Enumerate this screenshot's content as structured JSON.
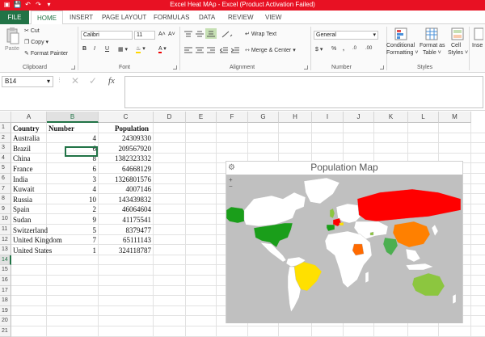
{
  "window": {
    "title": "Excel Heat MAp -  Excel (Product Activation Failed)"
  },
  "ribbon": {
    "tabs": [
      "FILE",
      "HOME",
      "INSERT",
      "PAGE LAYOUT",
      "FORMULAS",
      "DATA",
      "REVIEW",
      "VIEW"
    ],
    "clipboard": {
      "paste": "Paste",
      "cut": "Cut",
      "copy": "Copy",
      "format_painter": "Format Painter",
      "label": "Clipboard"
    },
    "font": {
      "name": "Calibri",
      "size": "11",
      "bold": "B",
      "italic": "I",
      "underline": "U",
      "grow": "A˄",
      "shrink": "A˅",
      "color_a": "A",
      "label": "Font"
    },
    "alignment": {
      "wrap": "Wrap Text",
      "merge": "Merge & Center",
      "label": "Alignment"
    },
    "number": {
      "format": "General",
      "currency": "$",
      "percent": "%",
      "comma": ",",
      "inc": ".0",
      "dec": ".00",
      "label": "Number"
    },
    "styles": {
      "conditional": "Conditional",
      "conditional2": "Formatting ˅",
      "format_as": "Format as",
      "format_as2": "Table ˅",
      "cell": "Cell",
      "cell2": "Styles ˅",
      "label": "Styles"
    },
    "insert": "Inse"
  },
  "formula_bar": {
    "name_box": "B14",
    "fx": "fx",
    "content": ""
  },
  "sheet": {
    "columns": [
      "A",
      "B",
      "C",
      "D",
      "E",
      "F",
      "G",
      "H",
      "I",
      "J",
      "K",
      "L",
      "M"
    ],
    "rows": [
      "1",
      "2",
      "3",
      "4",
      "5",
      "6",
      "7",
      "8",
      "9",
      "10",
      "11",
      "12",
      "13",
      "14",
      "15",
      "16",
      "17",
      "18",
      "19",
      "20",
      "21"
    ],
    "headers": [
      "Country",
      "Number",
      "Population"
    ],
    "data": [
      [
        "Australia",
        "4",
        "24309330"
      ],
      [
        "Brazil",
        "6",
        "209567920"
      ],
      [
        "China",
        "8",
        "1382323332"
      ],
      [
        "France",
        "6",
        "64668129"
      ],
      [
        "India",
        "3",
        "1326801576"
      ],
      [
        "Kuwait",
        "4",
        "4007146"
      ],
      [
        "Russia",
        "10",
        "143439832"
      ],
      [
        "Spain",
        "2",
        "46064604"
      ],
      [
        "Sudan",
        "9",
        "41175541"
      ],
      [
        "Switzerland",
        "5",
        "8379477"
      ],
      [
        "United Kingdom",
        "7",
        "65111143"
      ],
      [
        "United States",
        "1",
        "324118787"
      ]
    ]
  },
  "map": {
    "title": "Population Map",
    "gear": "⚙",
    "zoom_in": "+",
    "zoom_out": "−",
    "colors": {
      "ocean": "#c0c0c0",
      "land": "#ffffff",
      "russia": "#ff0000",
      "china": "#ff8000",
      "us": "#1a9e1a",
      "canada_alaska": "#1a9e1a",
      "australia": "#8cc63f",
      "brazil": "#ffe000",
      "india": "#4caf50",
      "sudan": "#ff6a00"
    }
  }
}
